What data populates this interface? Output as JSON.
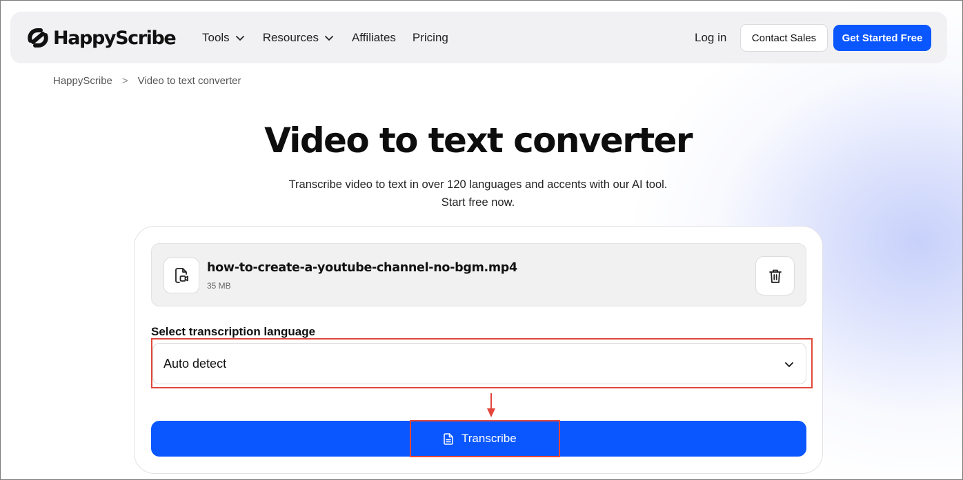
{
  "brand": {
    "name": "HappyScribe",
    "accent": "#0b57ff",
    "annotation": "#e2463b"
  },
  "nav": {
    "tools": "Tools",
    "resources": "Resources",
    "affiliates": "Affiliates",
    "pricing": "Pricing",
    "login": "Log in",
    "contact_sales": "Contact Sales",
    "get_started": "Get Started Free"
  },
  "breadcrumb": {
    "home": "HappyScribe",
    "separator": ">",
    "current": "Video to text converter"
  },
  "hero": {
    "title": "Video to text converter",
    "subtitle_line1": "Transcribe video to text in over 120 languages and accents with our AI tool.",
    "subtitle_line2": "Start free now."
  },
  "upload": {
    "file_name": "how-to-create-a-youtube-channel-no-bgm.mp4",
    "file_size": "35 MB",
    "file_icon": "video-file-icon",
    "delete_icon": "trash-icon"
  },
  "language": {
    "label": "Select transcription language",
    "selected": "Auto detect"
  },
  "actions": {
    "transcribe": "Transcribe",
    "transcribe_icon": "document-icon"
  }
}
